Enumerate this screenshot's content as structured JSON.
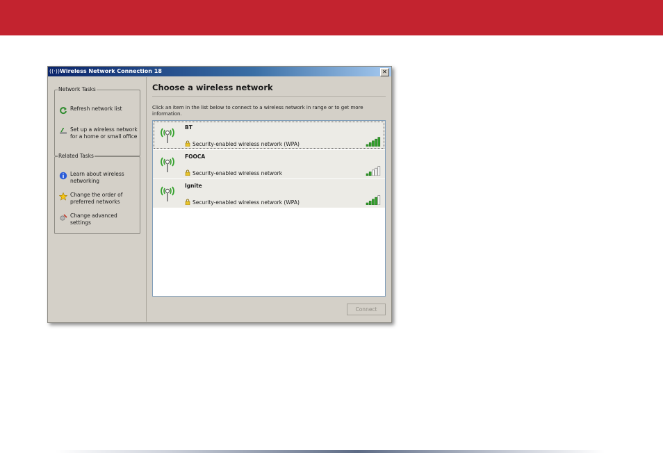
{
  "window": {
    "title": "Wireless Network Connection 18",
    "close_label": "✕",
    "antenna_glyph": "((·))"
  },
  "left_pane": {
    "network_tasks": {
      "title": "Network Tasks",
      "items": [
        {
          "label": "Refresh network list",
          "icon": "refresh-icon"
        },
        {
          "label": "Set up a wireless network for a home or small office",
          "icon": "setup-network-icon"
        }
      ]
    },
    "related_tasks": {
      "title": "Related Tasks",
      "items": [
        {
          "label": "Learn about wireless networking",
          "icon": "info-icon"
        },
        {
          "label": "Change the order of preferred networks",
          "icon": "star-icon"
        },
        {
          "label": "Change advanced settings",
          "icon": "settings-icon"
        }
      ]
    }
  },
  "main": {
    "title": "Choose a wireless network",
    "info": "Click an item in the list below to connect to a wireless network in range or to get more information.",
    "networks": [
      {
        "name": "BT",
        "security": "Security-enabled wireless network (WPA)",
        "signal_bars": 5
      },
      {
        "name": "FOOCA",
        "security": "Security-enabled wireless network",
        "signal_bars": 2
      },
      {
        "name": "Ignite",
        "security": "Security-enabled wireless network (WPA)",
        "signal_bars": 4
      }
    ],
    "connect_label": "Connect"
  },
  "colors": {
    "header_bar": "#c3232f",
    "signal_on": "#33a02c",
    "signal_off": "#ffffff"
  }
}
